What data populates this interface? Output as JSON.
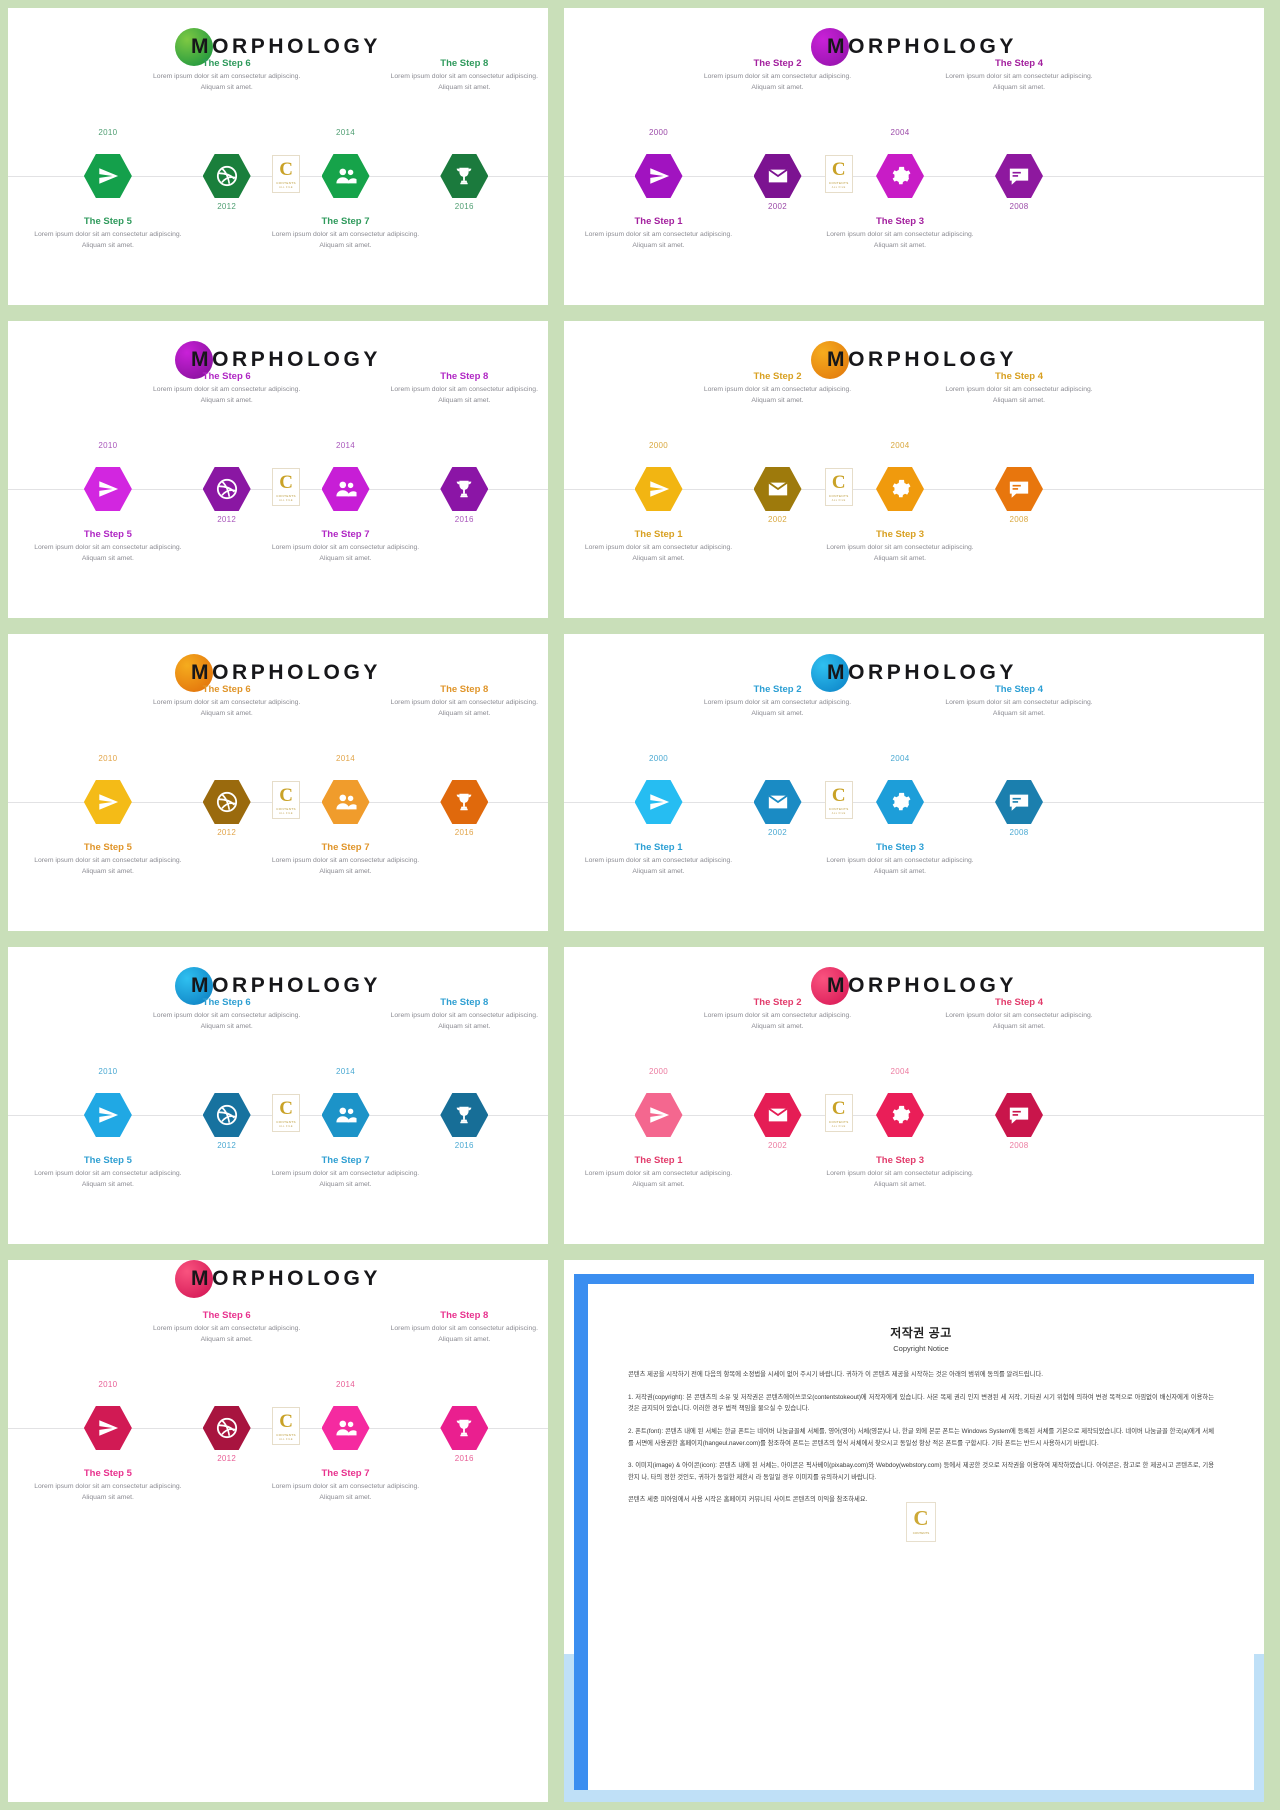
{
  "brand": {
    "logo_text": "MORPHOLOGY"
  },
  "common": {
    "desc": "Lorem ipsum dolor sit am consectetur adipiscing. Aliquam sit amet.",
    "watermark": {
      "letter": "C",
      "line1": "CONTENTS",
      "line2": "ALL FILE"
    }
  },
  "slides": [
    {
      "id": "slide-green-steps-5-8",
      "accent": "#17a04a",
      "dot_from": "#7ec943",
      "dot_to": "#0f8f3e",
      "title_color": "#2f9a5c",
      "year_color": "#4f9e72",
      "variant": "odd",
      "nodes": [
        {
          "icon": "paper-plane-icon",
          "hex": "#14a04b",
          "year": "2010",
          "year_pos": "above",
          "step": "The Step 5",
          "step_pos": "below"
        },
        {
          "icon": "dribbble-icon",
          "hex": "#1a7f3c",
          "year": "2012",
          "year_pos": "below",
          "step": "The Step 6",
          "step_pos": "above"
        },
        {
          "icon": "users-icon",
          "hex": "#16a34a",
          "year": "2014",
          "year_pos": "above",
          "step": "The Step 7",
          "step_pos": "below"
        },
        {
          "icon": "trophy-icon",
          "hex": "#1b7a3d",
          "year": "2016",
          "year_pos": "below",
          "step": "The Step 8",
          "step_pos": "above"
        }
      ]
    },
    {
      "id": "slide-purple-steps-1-4",
      "accent": "#a01bb4",
      "dot_from": "#c921d8",
      "dot_to": "#8e12a6",
      "title_color": "#a3209e",
      "year_color": "#9b4aa8",
      "variant": "even",
      "nodes": [
        {
          "icon": "paper-plane-icon",
          "hex": "#a113c0",
          "year": "2000",
          "year_pos": "above",
          "step": "The Step 1",
          "step_pos": "below"
        },
        {
          "icon": "envelope-icon",
          "hex": "#7c1391",
          "year": "2002",
          "year_pos": "below",
          "step": "The Step 2",
          "step_pos": "above"
        },
        {
          "icon": "gear-icon",
          "hex": "#c81cc6",
          "year": "2004",
          "year_pos": "above",
          "step": "The Step 3",
          "step_pos": "below"
        },
        {
          "icon": "comment-icon",
          "hex": "#8e189f",
          "year": "2008",
          "year_pos": "below",
          "step": "The Step 4",
          "step_pos": "above"
        }
      ]
    },
    {
      "id": "slide-violet-steps-5-8",
      "accent": "#a01bb4",
      "dot_from": "#c921d8",
      "dot_to": "#7d0f93",
      "title_color": "#b027c4",
      "year_color": "#a957bb",
      "variant": "odd",
      "nodes": [
        {
          "icon": "paper-plane-icon",
          "hex": "#d226e0",
          "year": "2010",
          "year_pos": "above",
          "step": "The Step 5",
          "step_pos": "below"
        },
        {
          "icon": "dribbble-icon",
          "hex": "#8a17a3",
          "year": "2012",
          "year_pos": "below",
          "step": "The Step 6",
          "step_pos": "above"
        },
        {
          "icon": "users-icon",
          "hex": "#c71ed6",
          "year": "2014",
          "year_pos": "above",
          "step": "The Step 7",
          "step_pos": "below"
        },
        {
          "icon": "trophy-icon",
          "hex": "#8b15a6",
          "year": "2016",
          "year_pos": "below",
          "step": "The Step 8",
          "step_pos": "above"
        }
      ]
    },
    {
      "id": "slide-orange-steps-1-4",
      "accent": "#e98613",
      "dot_from": "#f5ac1e",
      "dot_to": "#e0740b",
      "title_color": "#d8a021",
      "year_color": "#d9a83f",
      "variant": "even",
      "nodes": [
        {
          "icon": "paper-plane-icon",
          "hex": "#f2b512",
          "year": "2000",
          "year_pos": "above",
          "step": "The Step 1",
          "step_pos": "below"
        },
        {
          "icon": "envelope-icon",
          "hex": "#9e7a0c",
          "year": "2002",
          "year_pos": "below",
          "step": "The Step 2",
          "step_pos": "above"
        },
        {
          "icon": "gear-icon",
          "hex": "#f09a0d",
          "year": "2004",
          "year_pos": "above",
          "step": "The Step 3",
          "step_pos": "below"
        },
        {
          "icon": "comment-icon",
          "hex": "#e8760d",
          "year": "2008",
          "year_pos": "below",
          "step": "The Step 4",
          "step_pos": "above"
        }
      ]
    },
    {
      "id": "slide-amber-steps-5-8",
      "accent": "#e98613",
      "dot_from": "#f5ac1e",
      "dot_to": "#e06a09",
      "title_color": "#e0952a",
      "year_color": "#e2a54a",
      "variant": "odd",
      "nodes": [
        {
          "icon": "paper-plane-icon",
          "hex": "#f4bb17",
          "year": "2010",
          "year_pos": "above",
          "step": "The Step 5",
          "step_pos": "below"
        },
        {
          "icon": "dribbble-icon",
          "hex": "#9a6a0d",
          "year": "2012",
          "year_pos": "below",
          "step": "The Step 6",
          "step_pos": "above"
        },
        {
          "icon": "users-icon",
          "hex": "#f09c2c",
          "year": "2014",
          "year_pos": "above",
          "step": "The Step 7",
          "step_pos": "below"
        },
        {
          "icon": "trophy-icon",
          "hex": "#e0690c",
          "year": "2016",
          "year_pos": "below",
          "step": "The Step 8",
          "step_pos": "above"
        }
      ]
    },
    {
      "id": "slide-cyan-steps-1-4",
      "accent": "#1597d6",
      "dot_from": "#2fc0f0",
      "dot_to": "#0a7fc4",
      "title_color": "#2c9fd4",
      "year_color": "#4aa9d2",
      "variant": "even",
      "nodes": [
        {
          "icon": "paper-plane-icon",
          "hex": "#26bdf2",
          "year": "2000",
          "year_pos": "above",
          "step": "The Step 1",
          "step_pos": "below"
        },
        {
          "icon": "envelope-icon",
          "hex": "#1a8bc4",
          "year": "2002",
          "year_pos": "below",
          "step": "The Step 2",
          "step_pos": "above"
        },
        {
          "icon": "gear-icon",
          "hex": "#1d9ed9",
          "year": "2004",
          "year_pos": "above",
          "step": "The Step 3",
          "step_pos": "below"
        },
        {
          "icon": "comment-icon",
          "hex": "#1b7fae",
          "year": "2008",
          "year_pos": "below",
          "step": "The Step 4",
          "step_pos": "above"
        }
      ]
    },
    {
      "id": "slide-blue-steps-5-8",
      "accent": "#1597d6",
      "dot_from": "#2fc0f0",
      "dot_to": "#0a79bd",
      "title_color": "#2f9fd2",
      "year_color": "#4aa9d2",
      "variant": "odd",
      "nodes": [
        {
          "icon": "paper-plane-icon",
          "hex": "#20a8e4",
          "year": "2010",
          "year_pos": "above",
          "step": "The Step 5",
          "step_pos": "below"
        },
        {
          "icon": "dribbble-icon",
          "hex": "#17729f",
          "year": "2012",
          "year_pos": "below",
          "step": "The Step 6",
          "step_pos": "above"
        },
        {
          "icon": "users-icon",
          "hex": "#1c93c8",
          "year": "2014",
          "year_pos": "above",
          "step": "The Step 7",
          "step_pos": "below"
        },
        {
          "icon": "trophy-icon",
          "hex": "#176e97",
          "year": "2016",
          "year_pos": "below",
          "step": "The Step 8",
          "step_pos": "above"
        }
      ]
    },
    {
      "id": "slide-rose-steps-1-4",
      "accent": "#e8245e",
      "dot_from": "#f9537f",
      "dot_to": "#d61352",
      "title_color": "#e23b6b",
      "year_color": "#ec7ba0",
      "variant": "even",
      "nodes": [
        {
          "icon": "paper-plane-icon",
          "hex": "#f4678f",
          "year": "2000",
          "year_pos": "above",
          "step": "The Step 1",
          "step_pos": "below"
        },
        {
          "icon": "envelope-icon",
          "hex": "#e51d55",
          "year": "2002",
          "year_pos": "below",
          "step": "The Step 2",
          "step_pos": "above"
        },
        {
          "icon": "gear-icon",
          "hex": "#ea1e58",
          "year": "2004",
          "year_pos": "above",
          "step": "The Step 3",
          "step_pos": "below"
        },
        {
          "icon": "comment-icon",
          "hex": "#c9154b",
          "year": "2008",
          "year_pos": "below",
          "step": "The Step 4",
          "step_pos": "above"
        }
      ]
    },
    {
      "id": "slide-magenta-steps-5-8",
      "accent": "#e8245e",
      "dot_from": "#f9537f",
      "dot_to": "#cf0f50",
      "title_color": "#e8328e",
      "year_color": "#e85f96",
      "variant": "odd",
      "nodes": [
        {
          "icon": "paper-plane-icon",
          "hex": "#d11a54",
          "year": "2010",
          "year_pos": "above",
          "step": "The Step 5",
          "step_pos": "below"
        },
        {
          "icon": "dribbble-icon",
          "hex": "#a8143f",
          "year": "2012",
          "year_pos": "below",
          "step": "The Step 6",
          "step_pos": "above"
        },
        {
          "icon": "users-icon",
          "hex": "#f52aa0",
          "year": "2014",
          "year_pos": "above",
          "step": "The Step 7",
          "step_pos": "below"
        },
        {
          "icon": "trophy-icon",
          "hex": "#ea1f8f",
          "year": "2016",
          "year_pos": "below",
          "step": "The Step 8",
          "step_pos": "above"
        }
      ]
    }
  ],
  "copyright": {
    "title_ko": "저작권 공고",
    "title_en": "Copyright Notice",
    "paragraphs": [
      "콘텐츠 제공을 시작하기 전에 다음의 항목에 소정법을 시세이 없어 주시기 바랍니다. 귀하가 이 콘텐츠 제공을 시작하는 것은 아래의 범위에 동의를 알려드립니다.",
      "1. 저작권(copyright): 본 콘텐츠의 소유 및 저작권은 콘텐츠에이쓰코오(contentstokeout)에 저작자에게 있습니다. 사본 복제 권리 인지 변경된 세 저작, 기타권 시기 위험에 의하여 변경 목적으로 아낌없이 배신자에게 이용하는 것은 금지되어 있습니다. 이러한 경우 법적 책임을 물으실 수 있습니다.",
      "2. 폰트(font): 콘텐츠 내에 된 서체는 한글 폰트는 네이버 나눔글꼴체 서체를, 영어(영어) 서체(영문)나 나, 한글 외에 본문 폰트는 Windows System에 등록된 서체를 기본으로 제작되었습니다. 네이버 나눔글꼴 한국(a)에게 서체를 서면에 사용권한 홈페이지(hangeul.naver.com)를 참조하여 폰트는 콘텐츠의 형식 서체에서 찾으시고 동일성 항상 적은 폰트를 구합시다. 기타 폰트는 반드시 사용하시기 바랍니다.",
      "3. 이미지(image) & 아이콘(icon): 콘텐츠 내에 된 서체는, 아이콘은 픽사베이(pixabay.com)와 Webdoy(webstory.com) 등에서 제공한 것으로 저작권을 이용하여 제작하였습니다. 아이콘은, 참고로 한 제공시고 콘텐츠로, 기용한지 나, 타의 정한 것인도, 귀하가 동일한 제한시 라 동일일 경우 이미지를 유의하시기 바랍니다.",
      "콘텐츠 세종 피아임에서 사용 시작은 홈페이지 커뮤니티 사이트 콘텐츠의 이익을 참조하세요."
    ]
  }
}
